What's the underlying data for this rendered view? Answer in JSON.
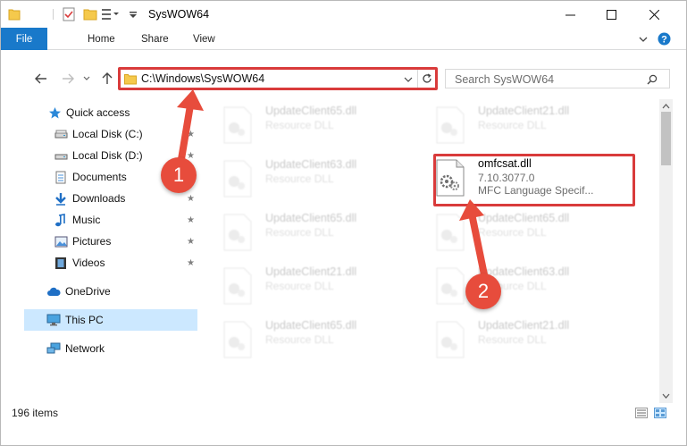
{
  "window": {
    "title": "SysWOW64"
  },
  "ribbon": {
    "file": "File",
    "home": "Home",
    "share": "Share",
    "view": "View"
  },
  "address": {
    "path": "C:\\Windows\\SysWOW64",
    "search_placeholder": "Search SysWOW64"
  },
  "sidebar": {
    "items": [
      {
        "label": "Quick access",
        "icon": "star-icon"
      },
      {
        "label": "Local Disk (C:)",
        "icon": "drive-icon"
      },
      {
        "label": "Local Disk (D:)",
        "icon": "drive-icon"
      },
      {
        "label": "Documents",
        "icon": "documents-icon"
      },
      {
        "label": "Downloads",
        "icon": "download-arrow-icon"
      },
      {
        "label": "Music",
        "icon": "music-note-icon"
      },
      {
        "label": "Pictures",
        "icon": "pictures-icon"
      },
      {
        "label": "Videos",
        "icon": "film-icon"
      },
      {
        "label": "OneDrive",
        "icon": "cloud-icon"
      },
      {
        "label": "This PC",
        "icon": "monitor-icon"
      },
      {
        "label": "Network",
        "icon": "network-icon"
      }
    ]
  },
  "files": [
    {
      "name": "UpdateClient65.dll",
      "desc": "Resource DLL"
    },
    {
      "name": "UpdateClient21.dll",
      "desc": "Resource DLL"
    },
    {
      "name": "UpdateClient63.dll",
      "desc": "Resource DLL"
    },
    {
      "name": "omfcsat.dll",
      "version": "7.10.3077.0",
      "desc": "MFC Language Specif..."
    },
    {
      "name": "UpdateClient65.dll",
      "desc": "Resource DLL"
    },
    {
      "name": "UpdateClient65.dll",
      "desc": "Resource DLL"
    },
    {
      "name": "UpdateClient21.dll",
      "desc": "Resource DLL"
    },
    {
      "name": "UpdateClient63.dll",
      "desc": "Resource DLL"
    },
    {
      "name": "UpdateClient65.dll",
      "desc": "Resource DLL"
    },
    {
      "name": "UpdateClient21.dll",
      "desc": "Resource DLL"
    }
  ],
  "status": {
    "item_count": "196 items"
  },
  "annotations": {
    "step1": "1",
    "step2": "2"
  },
  "colors": {
    "accent": "#1979ca",
    "annotation": "#e74c3c",
    "selection": "#cce8ff"
  }
}
